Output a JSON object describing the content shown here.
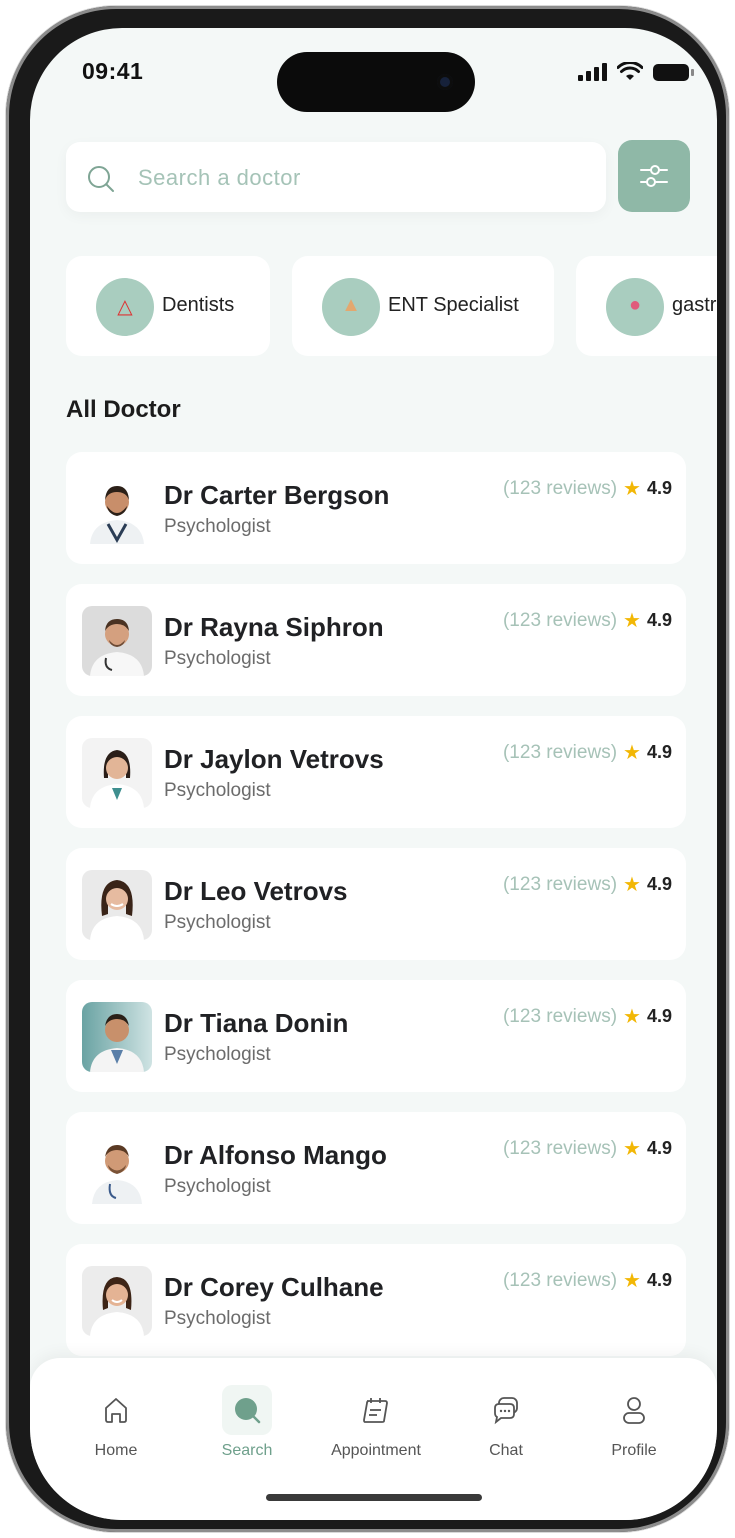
{
  "status": {
    "time": "09:41"
  },
  "search": {
    "placeholder": "Search a doctor"
  },
  "categories": [
    {
      "label": "Dentists",
      "icon": "tooth-icon"
    },
    {
      "label": "ENT Specialist",
      "icon": "nose-icon"
    },
    {
      "label": "gastr",
      "icon": "stomach-icon"
    }
  ],
  "section_title": "All Doctor",
  "doctors": [
    {
      "name": "Dr Carter Bergson",
      "specialty": "Psychologist",
      "reviews": "(123 reviews)",
      "rating": "4.9"
    },
    {
      "name": "Dr Rayna Siphron",
      "specialty": "Psychologist",
      "reviews": "(123 reviews)",
      "rating": "4.9"
    },
    {
      "name": "Dr Jaylon Vetrovs",
      "specialty": "Psychologist",
      "reviews": "(123 reviews)",
      "rating": "4.9"
    },
    {
      "name": "Dr Leo Vetrovs",
      "specialty": "Psychologist",
      "reviews": "(123 reviews)",
      "rating": "4.9"
    },
    {
      "name": "Dr Tiana Donin",
      "specialty": "Psychologist",
      "reviews": "(123 reviews)",
      "rating": "4.9"
    },
    {
      "name": "Dr Alfonso Mango",
      "specialty": "Psychologist",
      "reviews": "(123 reviews)",
      "rating": "4.9"
    },
    {
      "name": "Dr Corey Culhane",
      "specialty": "Psychologist",
      "reviews": "(123 reviews)",
      "rating": "4.9"
    }
  ],
  "tabs": [
    {
      "label": "Home",
      "icon": "home-icon"
    },
    {
      "label": "Search",
      "icon": "search-icon",
      "active": true
    },
    {
      "label": "Appointment",
      "icon": "calendar-icon"
    },
    {
      "label": "Chat",
      "icon": "chat-icon"
    },
    {
      "label": "Profile",
      "icon": "profile-icon"
    }
  ],
  "colors": {
    "accent": "#8fb8a7",
    "accent_light": "#a9cdbf",
    "background": "#f4f8f7",
    "star": "#f2b705"
  }
}
